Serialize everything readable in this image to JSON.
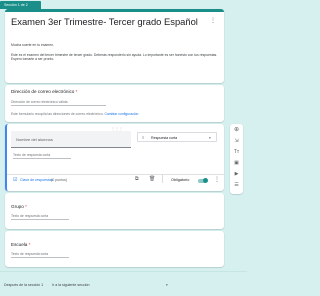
{
  "section_tab": "Sección 1 de 2",
  "header": {
    "title": "Examen 3er Trimestre- Tercer grado Español",
    "subtitle": "Mucha suerte en tu examen.",
    "description": "Este es el examen del tercer trimestre de tercer grado. Deberás responderlo sin ayuda. Lo importante es ser honesto con tus respuestas. Espero tomarte a ser pronto."
  },
  "email": {
    "label": "Dirección de correo electrónico",
    "required": "*",
    "placeholder": "Dirección de correo electrónico válida",
    "note": "Este formulario recopila las direcciones de correo electrónico.",
    "link": "Cambiar configuración"
  },
  "question_active": {
    "title_placeholder": "Nombre del alumnos",
    "type_label": "Respuesta corta",
    "answer_placeholder": "Texto de respuesta corta",
    "answer_key": "Clave de respuestas",
    "points": "(0 puntos)",
    "required_label": "Obligatorio"
  },
  "question_grupo": {
    "title": "Grupo",
    "required": "*",
    "answer_placeholder": "Texto de respuesta corta"
  },
  "question_escuela": {
    "title": "Escuela",
    "required": "*",
    "answer_placeholder": "Texto de respuesta corta"
  },
  "footer": {
    "after_section": "Después de la sección 1",
    "next_action": "Ir a la siguiente sección"
  },
  "colors": {
    "accent": "#1a8f89",
    "background": "#d6f0ef",
    "link": "#1a73e8"
  },
  "icons": [
    "more-vert-icon",
    "add-question-icon",
    "import-icon",
    "title-icon",
    "image-icon",
    "video-icon",
    "section-icon",
    "copy-icon",
    "delete-icon",
    "answer-key-icon",
    "dropdown-icon",
    "drag-handle-icon"
  ]
}
